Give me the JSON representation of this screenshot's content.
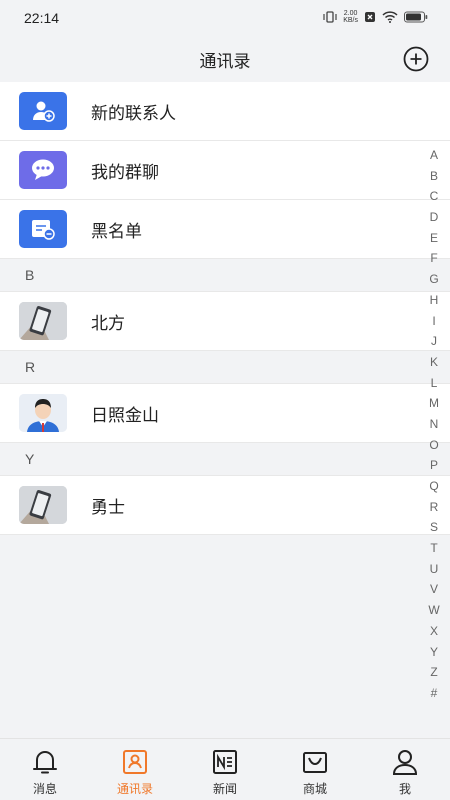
{
  "status_bar": {
    "time": "22:14",
    "speed_value": "2.00",
    "speed_unit": "KB/s"
  },
  "header": {
    "title": "通讯录"
  },
  "shortcuts": [
    {
      "label": "新的联系人",
      "icon": "add-user-icon"
    },
    {
      "label": "我的群聊",
      "icon": "chat-bubble-icon"
    },
    {
      "label": "黑名单",
      "icon": "blacklist-icon"
    }
  ],
  "sections": [
    {
      "letter": "B",
      "contacts": [
        {
          "name": "北方",
          "avatar": "phone-photo"
        }
      ]
    },
    {
      "letter": "R",
      "contacts": [
        {
          "name": "日照金山",
          "avatar": "cartoon-man"
        }
      ]
    },
    {
      "letter": "Y",
      "contacts": [
        {
          "name": "勇士",
          "avatar": "phone-photo"
        }
      ]
    }
  ],
  "index_letters": [
    "A",
    "B",
    "C",
    "D",
    "E",
    "F",
    "G",
    "H",
    "I",
    "J",
    "K",
    "L",
    "M",
    "N",
    "O",
    "P",
    "Q",
    "R",
    "S",
    "T",
    "U",
    "V",
    "W",
    "X",
    "Y",
    "Z",
    "#"
  ],
  "tabs": [
    {
      "label": "消息",
      "icon": "bell-icon"
    },
    {
      "label": "通讯录",
      "icon": "contacts-icon",
      "active": true
    },
    {
      "label": "新闻",
      "icon": "news-icon"
    },
    {
      "label": "商城",
      "icon": "mall-icon"
    },
    {
      "label": "我",
      "icon": "profile-icon"
    }
  ],
  "colors": {
    "accent": "#f0782a",
    "icon_blue": "#3a73e8",
    "icon_purple": "#6e6ce8",
    "background": "#f2f3f5"
  }
}
